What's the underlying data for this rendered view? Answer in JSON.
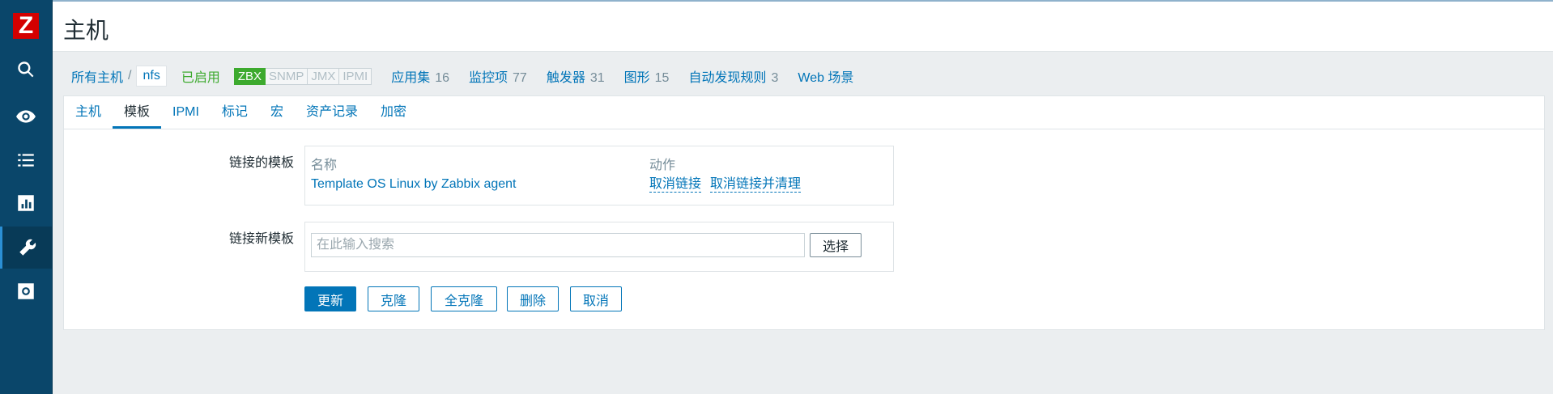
{
  "colors": {
    "sidebar": "#0a466a",
    "link": "#0275b8",
    "enabled": "#3daa2e",
    "logo": "#d40000"
  },
  "logo": {
    "text": "Z"
  },
  "sidebar": {
    "icons": [
      "search-icon",
      "eye-icon",
      "list-icon",
      "chart-icon",
      "wrench-icon",
      "gear-icon"
    ],
    "active": "wrench-icon"
  },
  "header": {
    "title": "主机"
  },
  "hostnav": {
    "all_hosts": "所有主机",
    "separator": "/",
    "current": "nfs",
    "status": "已启用",
    "availability": [
      "ZBX",
      "SNMP",
      "JMX",
      "IPMI"
    ],
    "items": [
      {
        "label": "应用集",
        "count": "16"
      },
      {
        "label": "监控项",
        "count": "77"
      },
      {
        "label": "触发器",
        "count": "31"
      },
      {
        "label": "图形",
        "count": "15"
      },
      {
        "label": "自动发现规则",
        "count": "3"
      },
      {
        "label": "Web 场景",
        "count": ""
      }
    ]
  },
  "tabs": [
    "主机",
    "模板",
    "IPMI",
    "标记",
    "宏",
    "资产记录",
    "加密"
  ],
  "active_tab": "模板",
  "form": {
    "linked_label": "链接的模板",
    "col_name": "名称",
    "col_action": "动作",
    "template_name": "Template OS Linux by Zabbix agent",
    "unlink": "取消链接",
    "unlink_clear": "取消链接并清理",
    "link_new_label": "链接新模板",
    "search_placeholder": "在此输入搜索",
    "select_button": "选择"
  },
  "buttons": {
    "update": "更新",
    "clone": "克隆",
    "full_clone": "全克隆",
    "delete": "删除",
    "cancel": "取消"
  }
}
